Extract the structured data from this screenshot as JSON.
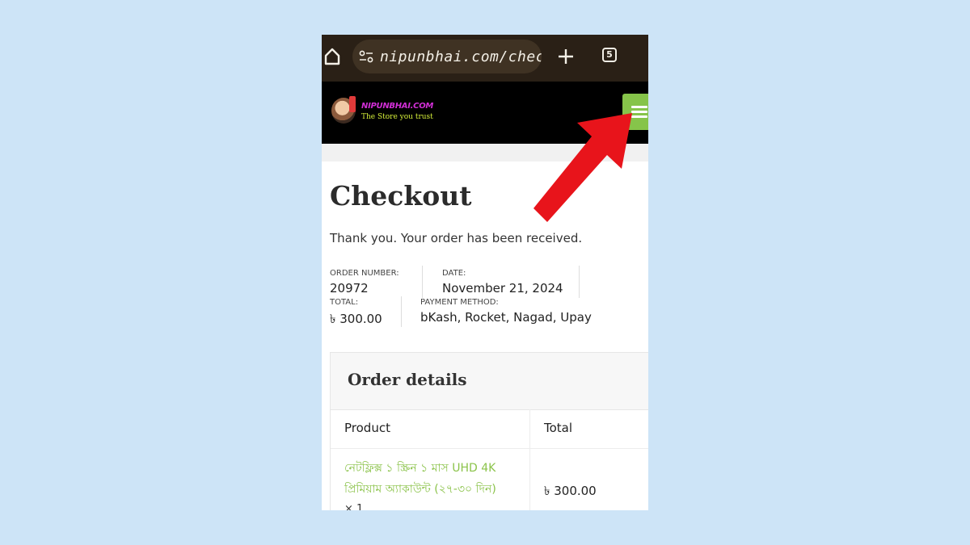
{
  "browser": {
    "url": "nipunbhai.com/checko",
    "tab_count": "5"
  },
  "header": {
    "logo_name": "NIPUNBHAI.COM",
    "logo_tagline": "The Store you trust"
  },
  "page": {
    "title": "Checkout",
    "thank_you": "Thank you. Your order has been received."
  },
  "overview": {
    "order_number_label": "ORDER NUMBER:",
    "order_number": "20972",
    "date_label": "DATE:",
    "date": "November 21, 2024",
    "total_label": "TOTAL:",
    "total": "৳ 300.00",
    "payment_label": "PAYMENT METHOD:",
    "payment": "bKash, Rocket, Nagad, Upay"
  },
  "order_details": {
    "title": "Order details",
    "col_product": "Product",
    "col_total": "Total",
    "product_name": "নেটফ্লিক্স ১ স্ক্রিন ১ মাস UHD 4K প্রিমিয়াম অ্যাকাউন্ট (২৭-৩০ দিন)",
    "quantity": "× 1",
    "line_total": "৳ 300.00"
  },
  "colors": {
    "page_bg": "#cde4f7",
    "browser_bar": "#2a2016",
    "menu_button": "#86c44a",
    "product_link": "#8bc34a",
    "arrow": "#e8141b"
  },
  "icons": [
    "home-icon",
    "site-settings-icon",
    "plus-icon",
    "tabs-icon",
    "hamburger-menu-icon",
    "red-arrow"
  ]
}
